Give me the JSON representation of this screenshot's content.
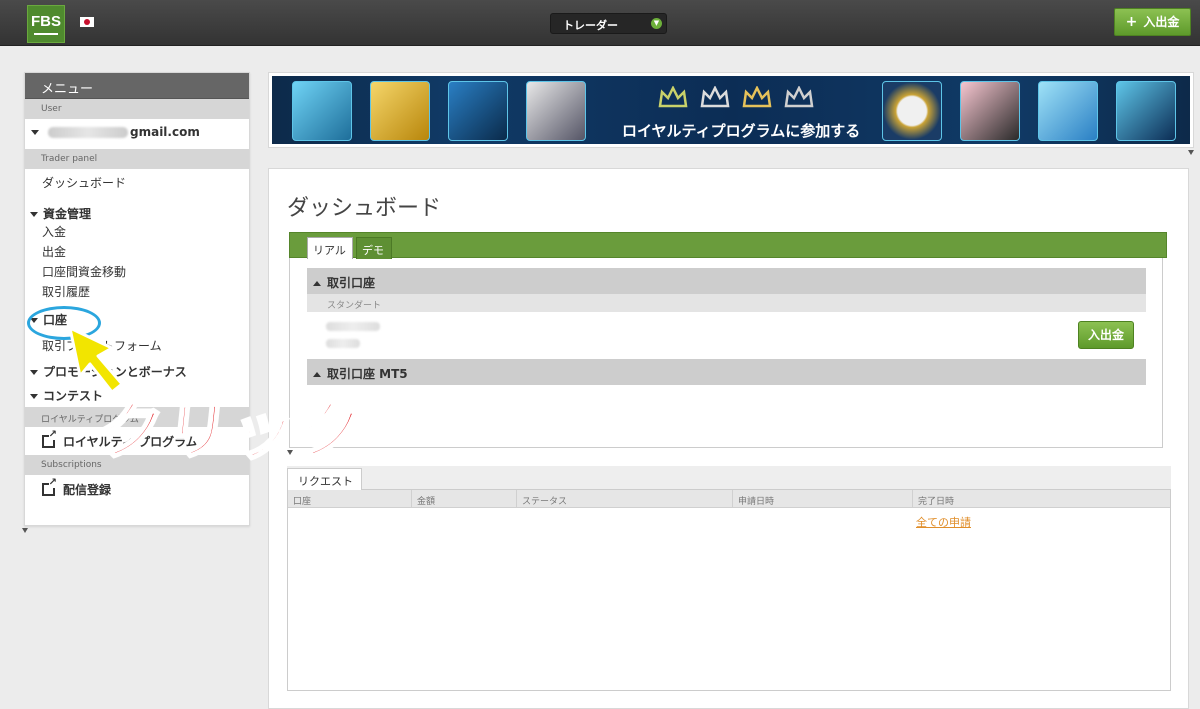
{
  "topbar": {
    "logo": "FBS",
    "trader_select": "トレーダー",
    "deposit_label": "入出金"
  },
  "sidebar": {
    "header": "メニュー",
    "section_user": "User",
    "user_email": "gmail.com",
    "section_trader": "Trader panel",
    "dashboard": "ダッシュボード",
    "funds_group": "資金管理",
    "funds_items": [
      "入金",
      "出金",
      "口座間資金移動",
      "取引履歴"
    ],
    "accounts_group": "口座",
    "platform": "取引プラットフォーム",
    "promo_group": "プロモーションとボーナス",
    "contest_group": "コンテスト",
    "section_loyalty": "ロイヤルティプログラム",
    "loyalty_link": "ロイヤルティ プログラム",
    "section_subscriptions": "Subscriptions",
    "subscriptions_link": "配信登録"
  },
  "banner": {
    "text": "ロイヤルティプログラムに参加する",
    "colors": {
      "bg": "#0c2d55",
      "tile_border": "#5ec5e8",
      "crown": "#c9d26a"
    }
  },
  "main": {
    "title": "ダッシュボード",
    "tabs": [
      "リアル",
      "デモ"
    ],
    "accounts_header": "取引口座",
    "standard_label": "スタンダート",
    "deposit_button": "入出金",
    "mt5_header": "取引口座 MT5",
    "request_tab": "リクエスト",
    "request_columns": [
      "口座",
      "金額",
      "ステータス",
      "申請日時",
      "完了日時"
    ],
    "all_requests": "全ての申請"
  },
  "overlay": {
    "click_text": "クリック",
    "circle_color": "#2ba6de",
    "arrow_color": "#f2e500",
    "text_color": "#e0141a"
  },
  "colors": {
    "accent_green": "#6a9c3c",
    "button_green": "#76ad3d",
    "link_orange": "#e08e2a"
  }
}
